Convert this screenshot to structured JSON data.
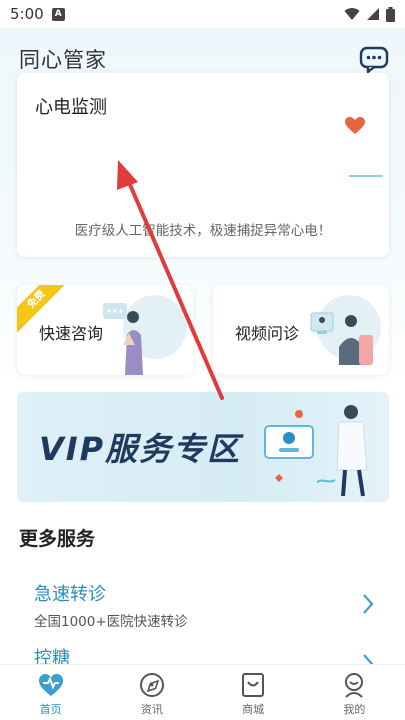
{
  "status": {
    "time": "5:00",
    "notif_letter": "A"
  },
  "header": {
    "title": "同心管家"
  },
  "ecg_card": {
    "title": "心电监测",
    "description": "医疗级人工智能技术，极速捕捉异常心电！"
  },
  "services": [
    {
      "label": "快速咨询",
      "badge": "免费"
    },
    {
      "label": "视频问诊"
    }
  ],
  "vip_banner": {
    "text": "VIP服务专区"
  },
  "more_services": {
    "title": "更多服务",
    "items": [
      {
        "title": "急速转诊",
        "subtitle": "全国1000+医院快速转诊"
      },
      {
        "title": "控糖",
        "subtitle": ""
      }
    ]
  },
  "nav": [
    {
      "label": "首页",
      "icon": "home-heart-icon",
      "active": true
    },
    {
      "label": "资讯",
      "icon": "news-icon",
      "active": false
    },
    {
      "label": "商城",
      "icon": "shop-bag-icon",
      "active": false
    },
    {
      "label": "我的",
      "icon": "profile-icon",
      "active": false
    }
  ],
  "colors": {
    "accent": "#2a8fc0",
    "heart": "#e8653d",
    "badge": "#f5c518",
    "arrow": "#e23b3b"
  }
}
